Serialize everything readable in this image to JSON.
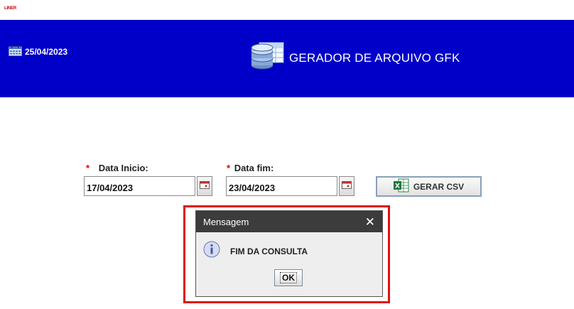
{
  "app": {
    "logo_text": "LINER",
    "date": "25/04/2023",
    "title": "GERADOR DE ARQUIVO GFK"
  },
  "form": {
    "start_label": "Data Inicio:",
    "start_value": "17/04/2023",
    "end_label": "Data fim:",
    "end_value": "23/04/2023",
    "required_mark": "*",
    "csv_button": "GERAR CSV"
  },
  "dialog": {
    "title": "Mensagem",
    "message": "FIM DA CONSULTA",
    "ok_label": "OK",
    "close_symbol": "✕"
  },
  "colors": {
    "banner": "#0000c8",
    "highlight_border": "#e01010",
    "required": "#e00000"
  },
  "icons": {
    "date": "calendar-icon",
    "title": "database-icon",
    "date_picker": "calendar-picker-icon",
    "csv": "excel-icon",
    "dialog": "info-icon"
  }
}
